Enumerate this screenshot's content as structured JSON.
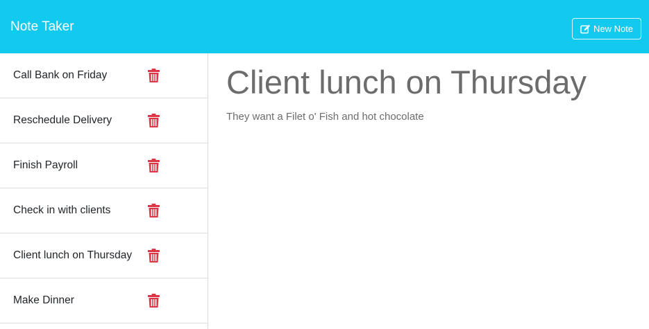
{
  "navbar": {
    "brand": "Note Taker",
    "new_note_label": "New Note",
    "color": "#12c9ee"
  },
  "notes": [
    {
      "title": "Call Bank on Friday",
      "icon": "trash-icon"
    },
    {
      "title": "Reschedule Delivery",
      "icon": "trash-icon"
    },
    {
      "title": "Finish Payroll",
      "icon": "trash-icon"
    },
    {
      "title": "Check in with clients",
      "icon": "trash-icon"
    },
    {
      "title": "Client lunch on Thursday",
      "icon": "trash-icon"
    },
    {
      "title": "Make Dinner",
      "icon": "trash-icon"
    }
  ],
  "active_note": {
    "title": "Client lunch on Thursday",
    "text": "They want a Filet o' Fish and hot chocolate"
  },
  "colors": {
    "delete": "#dc3545",
    "note_text": "#6c6c6c"
  }
}
